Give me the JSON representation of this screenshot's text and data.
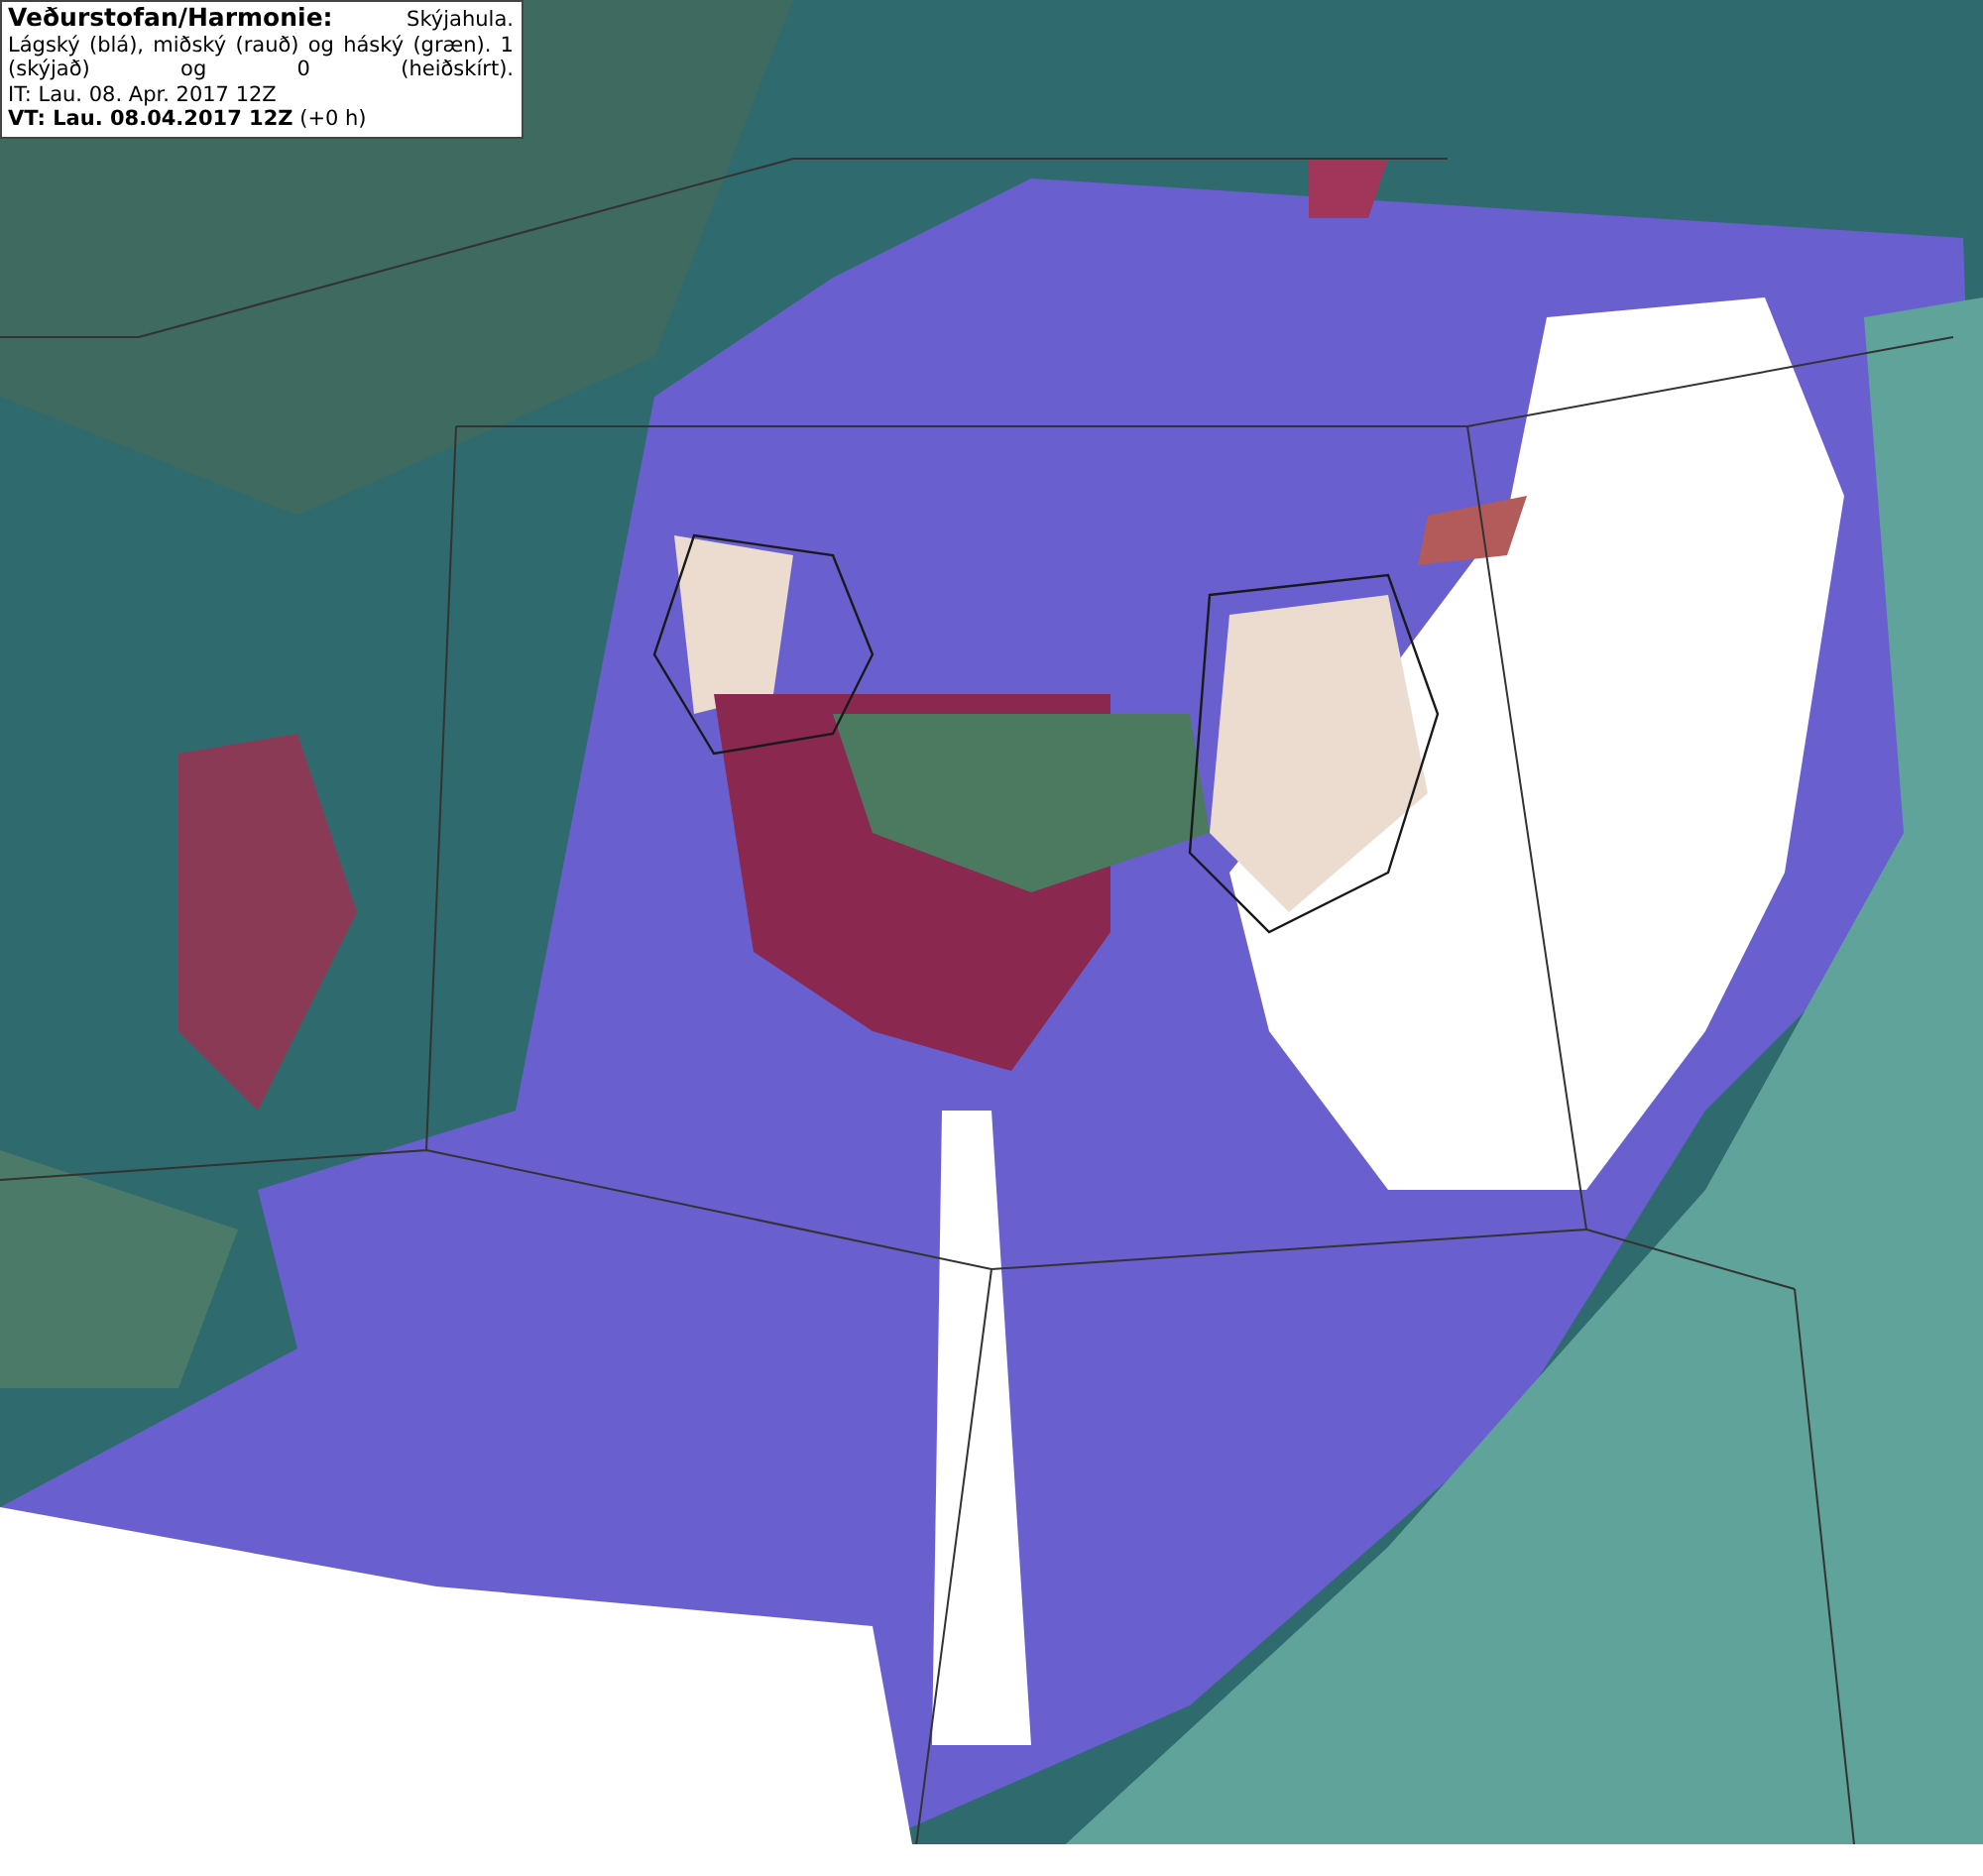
{
  "legend": {
    "description": "**Veðurstofan/Harmonie:** Skýjahula. Lágský (blá), miðský (rauð) og háský (græn). 1 (skýjað) og 0 (heiðskírt).",
    "initial_time": "IT: Lau. 08. Apr. 2017 12Z",
    "valid_time": "**VT: Lau. 08.04.2017 12Z** (+0 h)"
  }
}
